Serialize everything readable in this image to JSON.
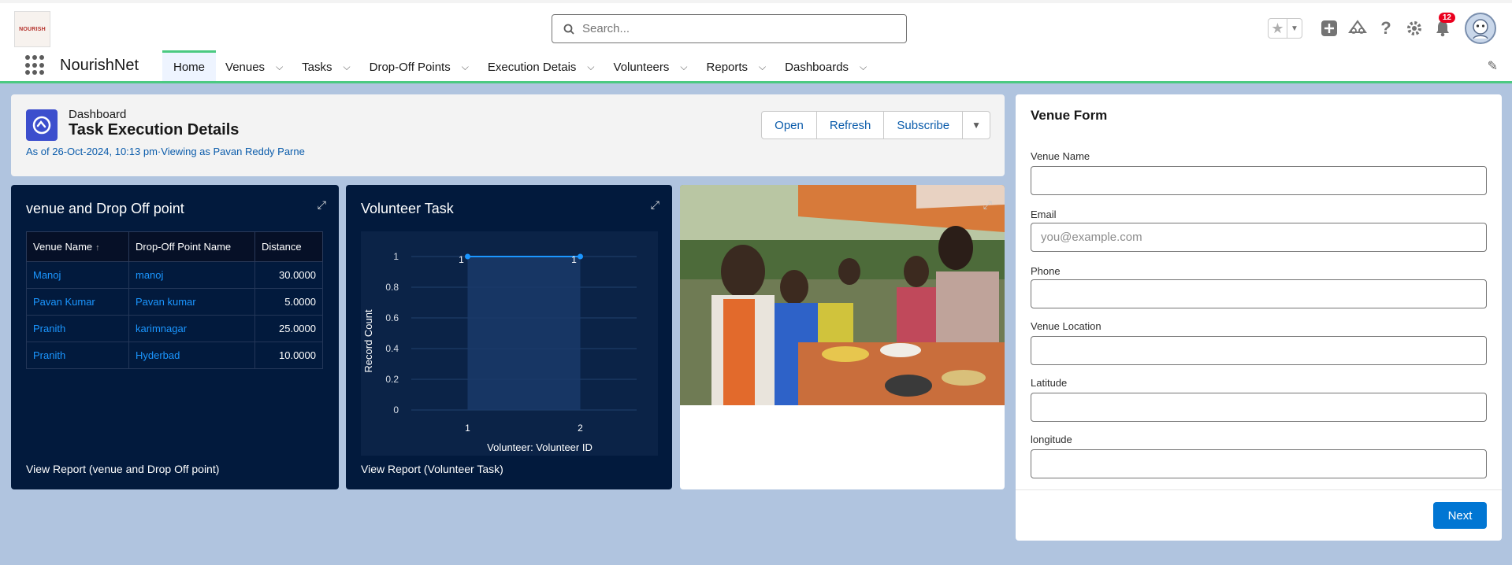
{
  "header": {
    "logo_text": "NOURISH",
    "search_placeholder": "Search...",
    "notification_count": "12"
  },
  "nav": {
    "app_name": "NourishNet",
    "items": [
      {
        "label": "Home",
        "active": true
      },
      {
        "label": "Venues"
      },
      {
        "label": "Tasks"
      },
      {
        "label": "Drop-Off Points"
      },
      {
        "label": "Execution Detais"
      },
      {
        "label": "Volunteers"
      },
      {
        "label": "Reports"
      },
      {
        "label": "Dashboards"
      }
    ]
  },
  "dashboard": {
    "type_label": "Dashboard",
    "title": "Task Execution Details",
    "subtitle": "As of 26-Oct-2024, 10:13 pm·Viewing as Pavan Reddy Parne",
    "buttons": {
      "open": "Open",
      "refresh": "Refresh",
      "subscribe": "Subscribe"
    }
  },
  "widget_venue": {
    "title": "venue and Drop Off point",
    "columns": [
      "Venue Name",
      "Drop-Off Point Name",
      "Distance"
    ],
    "rows": [
      {
        "venue": "Manoj",
        "dropoff": "manoj",
        "distance": "30.0000"
      },
      {
        "venue": "Pavan Kumar",
        "dropoff": "Pavan kumar",
        "distance": "5.0000"
      },
      {
        "venue": "Pranith",
        "dropoff": "karimnagar",
        "distance": "25.0000"
      },
      {
        "venue": "Pranith",
        "dropoff": "Hyderbad",
        "distance": "10.0000"
      }
    ],
    "footer": "View Report (venue and Drop Off point)"
  },
  "widget_volunteer": {
    "title": "Volunteer Task",
    "footer": "View Report (Volunteer Task)"
  },
  "chart_data": {
    "type": "area",
    "x": [
      1,
      2
    ],
    "values": [
      1,
      1
    ],
    "xlabel": "Volunteer: Volunteer ID",
    "ylabel": "Record Count",
    "ylim": [
      0,
      1
    ],
    "yticks": [
      "0",
      "0.2",
      "0.4",
      "0.6",
      "0.8",
      "1"
    ],
    "xticks": [
      "1",
      "2"
    ],
    "data_labels": [
      "1",
      "1"
    ],
    "colors": {
      "line": "#1b96ff",
      "fill": "#1a3a6a"
    },
    "grid": true
  },
  "venue_form": {
    "title": "Venue Form",
    "fields": [
      {
        "label": "Venue Name",
        "placeholder": ""
      },
      {
        "label": "Email",
        "placeholder": "you@example.com"
      },
      {
        "label": "Phone",
        "placeholder": ""
      },
      {
        "label": "Venue Location",
        "placeholder": ""
      },
      {
        "label": "Latitude",
        "placeholder": ""
      },
      {
        "label": "longitude",
        "placeholder": ""
      }
    ],
    "next_label": "Next"
  }
}
